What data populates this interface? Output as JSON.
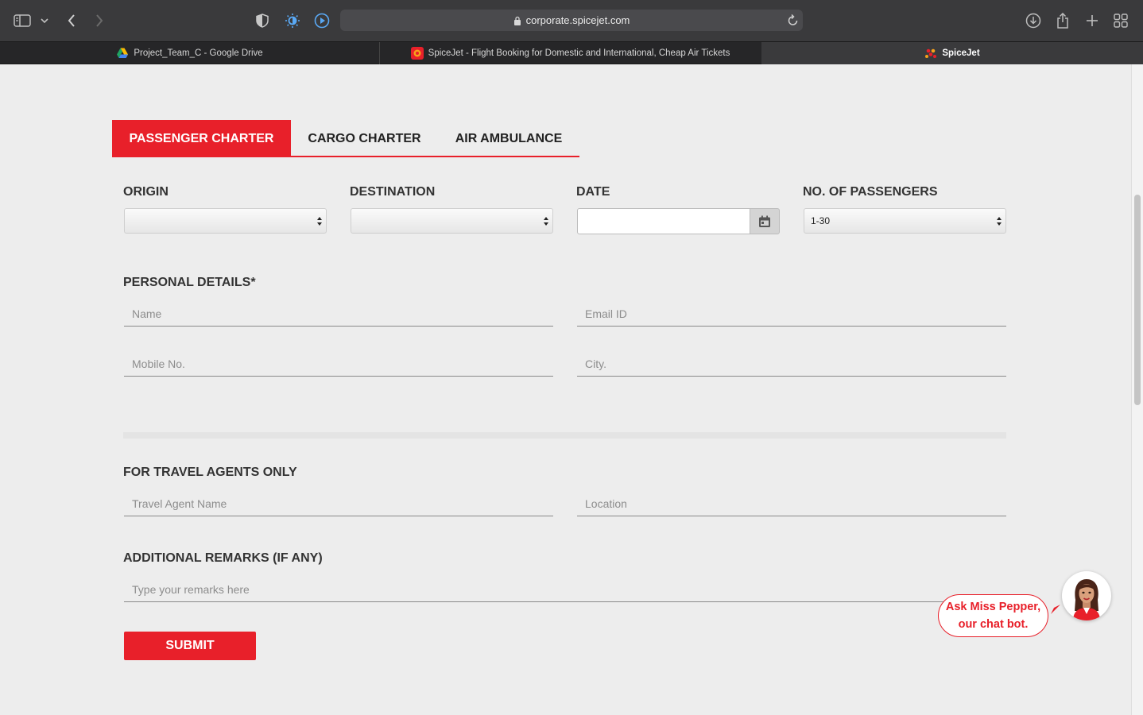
{
  "browser": {
    "url": "corporate.spicejet.com",
    "tabs": [
      {
        "label": "Project_Team_C - Google Drive"
      },
      {
        "label": "SpiceJet - Flight Booking for Domestic and International, Cheap Air Tickets"
      },
      {
        "label": "SpiceJet"
      }
    ]
  },
  "charter_tabs": [
    {
      "label": "PASSENGER CHARTER",
      "active": true
    },
    {
      "label": "CARGO CHARTER"
    },
    {
      "label": "AIR AMBULANCE"
    }
  ],
  "trip": {
    "origin_label": "ORIGIN",
    "destination_label": "DESTINATION",
    "date_label": "DATE",
    "passengers_label": "NO. OF PASSENGERS",
    "origin_value": "",
    "destination_value": "",
    "passengers_value": "1-30"
  },
  "personal": {
    "heading": "PERSONAL DETAILS*",
    "name_placeholder": "Name",
    "email_placeholder": "Email ID",
    "mobile_placeholder": "Mobile No.",
    "city_placeholder": "City."
  },
  "agents": {
    "heading": "FOR TRAVEL AGENTS ONLY",
    "agent_placeholder": "Travel Agent Name",
    "location_placeholder": "Location"
  },
  "remarks": {
    "heading": "ADDITIONAL REMARKS (IF ANY)",
    "placeholder": "Type your remarks here"
  },
  "submit_label": "SUBMIT",
  "chatbot": {
    "line1": "Ask Miss Pepper,",
    "line2": "our chat bot."
  },
  "colors": {
    "brand_red": "#e8202a",
    "chrome_dark": "#3a3a3c"
  }
}
